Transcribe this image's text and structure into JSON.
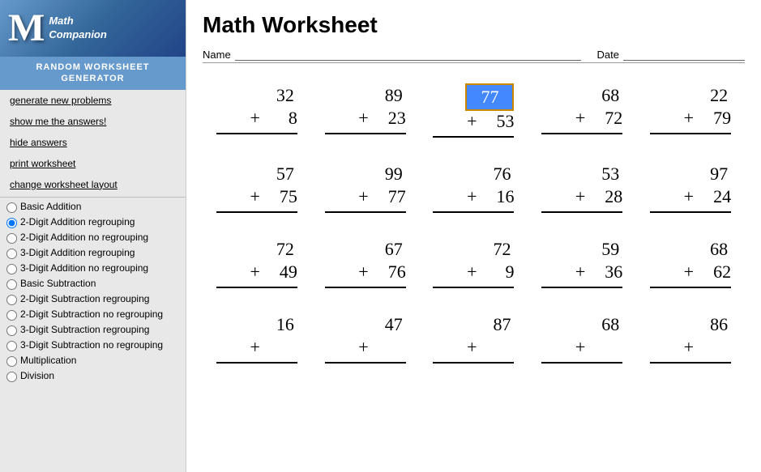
{
  "sidebar": {
    "logo_m": "M",
    "logo_text_line1": "Math",
    "logo_text_line2": "Companion",
    "generator_title_line1": "RANDOM WORKSHEET",
    "generator_title_line2": "GENERATOR",
    "links": [
      {
        "id": "generate",
        "label": "generate new problems"
      },
      {
        "id": "show-answers",
        "label": "show me the answers!"
      },
      {
        "id": "hide-answers",
        "label": "hide answers"
      },
      {
        "id": "print",
        "label": "print worksheet"
      },
      {
        "id": "change-layout",
        "label": "change worksheet layout"
      }
    ],
    "radio_options": [
      {
        "id": "basic-addition",
        "label": "Basic Addition",
        "checked": false
      },
      {
        "id": "2digit-add-regroup",
        "label": "2-Digit Addition regrouping",
        "checked": true
      },
      {
        "id": "2digit-add-no-regroup",
        "label": "2-Digit Addition no regrouping",
        "checked": false
      },
      {
        "id": "3digit-add-regroup",
        "label": "3-Digit Addition regrouping",
        "checked": false
      },
      {
        "id": "3digit-add-no-regroup",
        "label": "3-Digit Addition no regrouping",
        "checked": false
      },
      {
        "id": "basic-subtraction",
        "label": "Basic Subtraction",
        "checked": false
      },
      {
        "id": "2digit-sub-regroup",
        "label": "2-Digit Subtraction regrouping",
        "checked": false
      },
      {
        "id": "2digit-sub-no-regroup",
        "label": "2-Digit Subtraction no regrouping",
        "checked": false
      },
      {
        "id": "3digit-sub-regroup",
        "label": "3-Digit Subtraction regrouping",
        "checked": false
      },
      {
        "id": "3digit-sub-no-regroup",
        "label": "3-Digit Subtraction no regrouping",
        "checked": false
      },
      {
        "id": "multiplication",
        "label": "Multiplication",
        "checked": false
      },
      {
        "id": "division",
        "label": "Division",
        "checked": false
      }
    ]
  },
  "worksheet": {
    "title": "Math Worksheet",
    "name_label": "Name",
    "date_label": "Date",
    "problems": [
      [
        {
          "top": "32",
          "op": "+",
          "bottom": "8",
          "highlighted": false
        },
        {
          "top": "89",
          "op": "+",
          "bottom": "23",
          "highlighted": false
        },
        {
          "top": "77",
          "op": "+",
          "bottom": "53",
          "highlighted": true
        },
        {
          "top": "68",
          "op": "+",
          "bottom": "72",
          "highlighted": false
        },
        {
          "top": "22",
          "op": "+",
          "bottom": "79",
          "highlighted": false
        }
      ],
      [
        {
          "top": "57",
          "op": "+",
          "bottom": "75",
          "highlighted": false
        },
        {
          "top": "99",
          "op": "+",
          "bottom": "77",
          "highlighted": false
        },
        {
          "top": "76",
          "op": "+",
          "bottom": "16",
          "highlighted": false
        },
        {
          "top": "53",
          "op": "+",
          "bottom": "28",
          "highlighted": false
        },
        {
          "top": "97",
          "op": "+",
          "bottom": "24",
          "highlighted": false
        }
      ],
      [
        {
          "top": "72",
          "op": "+",
          "bottom": "49",
          "highlighted": false
        },
        {
          "top": "67",
          "op": "+",
          "bottom": "76",
          "highlighted": false
        },
        {
          "top": "72",
          "op": "+",
          "bottom": "9",
          "highlighted": false
        },
        {
          "top": "59",
          "op": "+",
          "bottom": "36",
          "highlighted": false
        },
        {
          "top": "68",
          "op": "+",
          "bottom": "62",
          "highlighted": false
        }
      ],
      [
        {
          "top": "16",
          "op": "+",
          "bottom": "??",
          "highlighted": false
        },
        {
          "top": "47",
          "op": "+",
          "bottom": "??",
          "highlighted": false
        },
        {
          "top": "87",
          "op": "+",
          "bottom": "??",
          "highlighted": false
        },
        {
          "top": "68",
          "op": "+",
          "bottom": "??",
          "highlighted": false
        },
        {
          "top": "86",
          "op": "+",
          "bottom": "??",
          "highlighted": false
        }
      ]
    ]
  }
}
